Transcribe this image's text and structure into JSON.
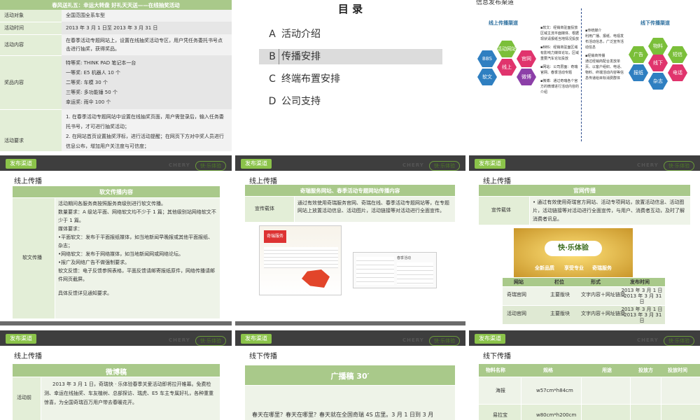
{
  "s1": {
    "title": "春风送礼五：幸运大转盘  好礼天天送——在线抽奖活动",
    "rows": [
      {
        "k": "活动对象",
        "v": "全国范围全系车型"
      },
      {
        "k": "活动时间",
        "v": "2013 年 3 月 1 日至 2013 年 3 月 31 日"
      },
      {
        "k": "活动内容",
        "v": "在春季活动专题网站上，设置在线抽奖活动专区，用户凭任务委托书号点击进行抽奖，获得奖品。"
      },
      {
        "k": "奖品内容",
        "v": [
          "特等奖:   THINK PAD 笔记本一台",
          "一等奖:   E5 机器人 10 个",
          "二等奖:   车模 30 个",
          "三等奖:   多功能锤 50 个",
          "幸运奖:   雨伞 100 个"
        ]
      },
      {
        "k": "活动要求",
        "v": [
          "1. 在春季活动专题网站中设置在线抽奖页面，用户需登录后，输入任务委托书号，才可进行抽奖活动；",
          "2. 在网站首页设置抽奖浮标，进行活动提醒；在网页下方对中奖人员进行信息公布，增加用户关注度与可信度；"
        ]
      }
    ]
  },
  "s2": {
    "title": "目    录",
    "items": [
      {
        "l": "A",
        "t": "活动介绍"
      },
      {
        "l": "B",
        "t": "传播安排"
      },
      {
        "l": "C",
        "t": "终端布置安排"
      },
      {
        "l": "D",
        "t": "公司支持"
      }
    ]
  },
  "s3": {
    "title": "信息发布渠道",
    "online": "线上传播渠道",
    "offline": "线下传播渠道",
    "hex_left": [
      "活动网站",
      "BBS",
      "线上",
      "官网",
      "软文",
      "微博"
    ],
    "hex_right": [
      "物料",
      "广告",
      "短信",
      "线下",
      "报纸",
      "电话",
      "杂志"
    ],
    "notes": [
      "▪软文：经销商驻面投放区域主流平面媒体、根据现状请报纸当地情况投放",
      "▪BBS：经销商驻面区域有影响力媒体论坛，区域重要汽车论坛投放",
      "▪网站：公司层面：奇瑞官网、春季活动专题",
      "▪微博：通过奇瑞各个官方的微博进行活动内容的介绍"
    ],
    "right_notes": [
      "▪传统媒介",
      "利用广播、报纸、电视发布活动信息，广泛宣传活动信息",
      "▪经销商传播",
      "通过经销商配合发放单页、以客户组织、电话、物料、终端活动内容等信息传递给目标消费群体"
    ]
  },
  "s4": {
    "tag": "发布渠道",
    "brand": "CHERY",
    "sub": "快·乐体验",
    "heading": "线上传播",
    "table_title": "软文传播内容",
    "k": "软文传播",
    "lines": [
      "活动期间各服务商按照服务商级别进行软文传播。",
      "数量要求：A 级站平面、网络软文均不少于 1 篇；其他级别站网络软文不少于 1 篇。",
      "媒体要求：",
      "   •平面软文：发布于平面报纸媒体，如当地新闻早晚报或其他平面报纸、杂志；",
      "   •网络软文：发布于网络媒体，如当地新闻网或网络论坛。",
      "   •报广及网络广告不做强制要求。",
      "软文反馈：电子反馈参照表格，平面反馈请邮寄报纸原件，网络传播请邮件网页截屏。",
      "",
      "具体反馈详见通知要求。"
    ]
  },
  "s5": {
    "tag": "发布渠道",
    "brand": "CHERY",
    "sub": "快·乐体验",
    "heading": "线上传播",
    "table_title": "奇瑞服务网站、春季活动专题网站传播内容",
    "k": "宣传载体",
    "v": "通过有效使用奇瑞服务官网、奇瑞在线、春季活动专题网站等，在专题网站上放置活动信息、活动图片，活动链接等对活动进行全面宣传。",
    "pic_labels": [
      "奇瑞服务",
      "春季活动"
    ]
  },
  "s6": {
    "tag": "发布渠道",
    "brand": "CHERY",
    "sub": "快·乐体验",
    "heading": "线上传播",
    "table_title": "官网传播",
    "k": "宣传载体",
    "v": "• 通过有效使用奇瑞官方网站、活动专项网站，放置活动信息、活动图片，活动链接等对活动进行全面宣传，与用户、消费者互动，及时了解消费者讯息。",
    "banner": "快·乐体验",
    "banner_btns": [
      "全新品质",
      "享受专业",
      "奇瑞服务"
    ],
    "cols": [
      "网站",
      "栏位",
      "形式",
      "发布时间"
    ],
    "rows": [
      [
        "奇瑞官网",
        "主要版块",
        "文字内容＋网址链接",
        "2013 年 3 月 1 日 -2013 年 3 月 31 日"
      ],
      [
        "活动官网",
        "主要版块",
        "文字内容＋网址链接",
        "2013 年 3 月 1 日 -2013 年 3 月 31 日"
      ]
    ]
  },
  "s7": {
    "tag": "发布渠道",
    "brand": "CHERY",
    "sub": "快·乐体验",
    "heading": "线上传播",
    "table_title": "微博稿",
    "k": "活动前",
    "v": "2013 年 3 月 1 日，奇瑞快 · 乐体验春季关爱活动即将拉开帷幕。免费检测、幸运在线抽奖、车友植树、总部探访、瑞虎、E5 车主专属好礼，各种重重惊喜，为全国奇瑞百万用户带去春暖花开。"
  },
  "s8": {
    "tag": "发布渠道",
    "brand": "CHERY",
    "sub": "快·乐体验",
    "heading": "线下传播",
    "table_title": "广播稿    30′",
    "v": "春天在哪里？春天在哪里？春天就在全国奇瑞 4S 店里。3 月 1 日到 3 月"
  },
  "s9": {
    "tag": "发布渠道",
    "brand": "CHERY",
    "sub": "快·乐体验",
    "heading": "线下传播",
    "cols": [
      "物料名称",
      "规格",
      "用途",
      "投放方",
      "投放时间"
    ],
    "rows": [
      [
        "海报",
        "w57cm*h84cm"
      ],
      [
        "易拉宝",
        "w80cm*h200cm"
      ]
    ]
  }
}
